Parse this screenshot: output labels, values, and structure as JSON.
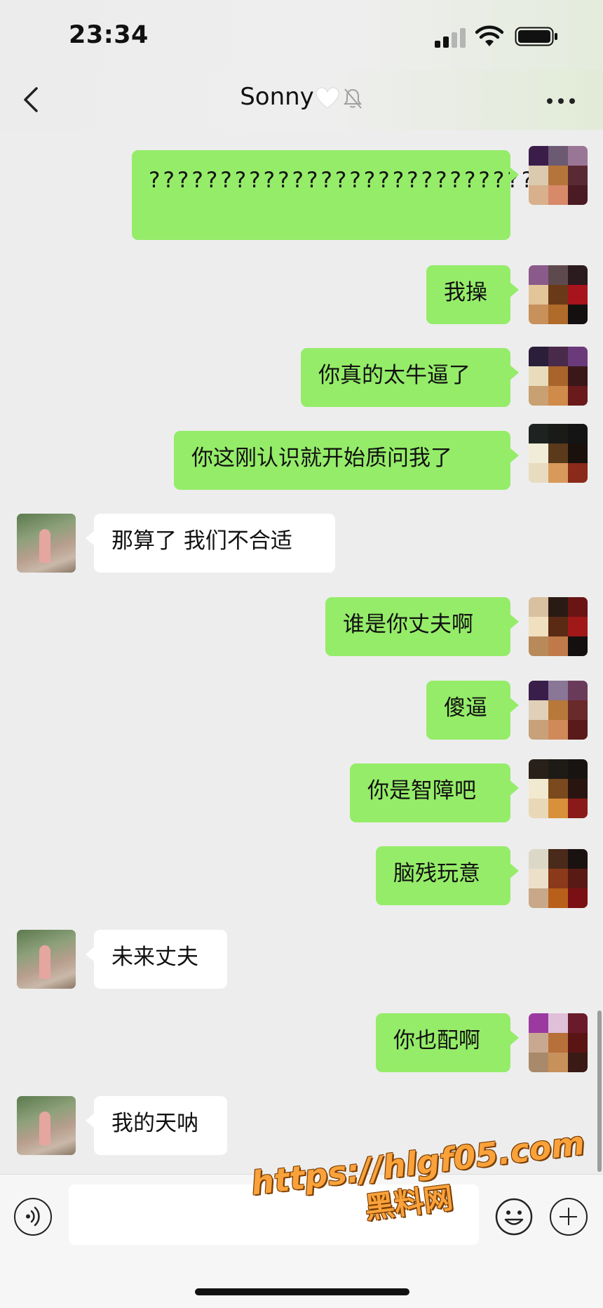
{
  "status_bar": {
    "time": "23:34"
  },
  "header": {
    "title": "Sonny",
    "heart_icon": "white-heart-icon",
    "mute_icon": "muted-bell-icon"
  },
  "messages": [
    {
      "from": "me",
      "text": "???????????????????????????"
    },
    {
      "from": "me",
      "text": "我操"
    },
    {
      "from": "me",
      "text": "你真的太牛逼了"
    },
    {
      "from": "me",
      "text": "你这刚认识就开始质问我了"
    },
    {
      "from": "them",
      "text": "那算了 我们不合适"
    },
    {
      "from": "me",
      "text": "谁是你丈夫啊"
    },
    {
      "from": "me",
      "text": "傻逼"
    },
    {
      "from": "me",
      "text": "你是智障吧"
    },
    {
      "from": "me",
      "text": "脑残玩意"
    },
    {
      "from": "them",
      "text": "未来丈夫"
    },
    {
      "from": "me",
      "text": "你也配啊"
    },
    {
      "from": "them",
      "text": "我的天呐"
    }
  ],
  "watermark": {
    "url": "https://hlgf05.com",
    "site": "黑料网"
  },
  "colors": {
    "my_bubble": "#95ec69",
    "their_bubble": "#ffffff",
    "background": "#ededed"
  }
}
